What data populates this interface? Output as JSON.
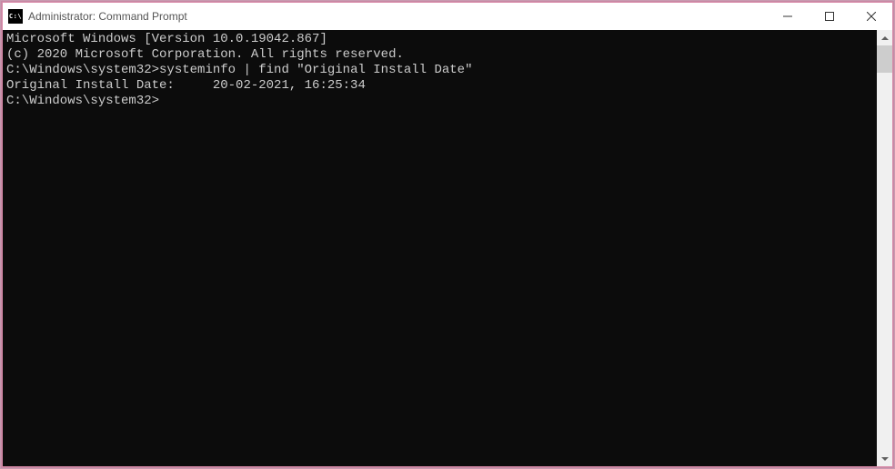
{
  "window": {
    "title": "Administrator: Command Prompt",
    "icon_label": "C:\\"
  },
  "titlebar_buttons": {
    "minimize_name": "minimize-button",
    "maximize_name": "maximize-button",
    "close_name": "close-button"
  },
  "terminal": {
    "line1": "Microsoft Windows [Version 10.0.19042.867]",
    "line2": "(c) 2020 Microsoft Corporation. All rights reserved.",
    "blank1": "",
    "prompt1_path": "C:\\Windows\\system32>",
    "prompt1_command": "systeminfo | find \"Original Install Date\"",
    "output1": "Original Install Date:     20-02-2021, 16:25:34",
    "blank2": "",
    "prompt2_path": "C:\\Windows\\system32>",
    "prompt2_command": ""
  }
}
